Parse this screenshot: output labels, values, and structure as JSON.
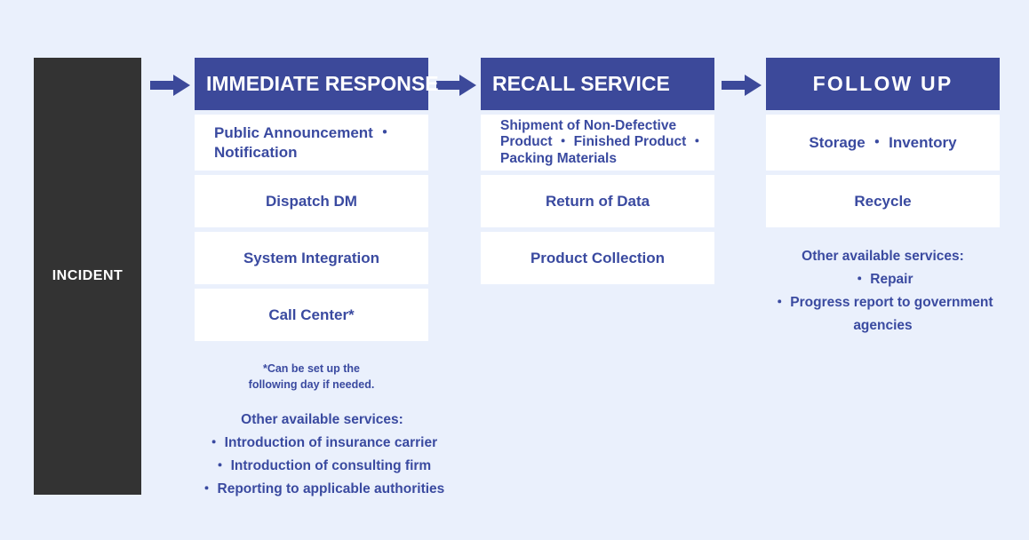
{
  "colors": {
    "background": "#eaf0fc",
    "header_blue": "#3c499a",
    "text_blue": "#3a4aa0",
    "incident_dark": "#333333",
    "box_white": "#ffffff"
  },
  "incident": {
    "label": "INCIDENT"
  },
  "arrows": [
    {
      "name": "arrow-incident-to-immediate"
    },
    {
      "name": "arrow-immediate-to-recall"
    },
    {
      "name": "arrow-recall-to-followup"
    }
  ],
  "columns": [
    {
      "id": "immediate-response",
      "header": "IMMEDIATE RESPONSE",
      "items": [
        {
          "text": "Public Announcement ・\nNotification",
          "align": "left",
          "size": "std",
          "height": "tall"
        },
        {
          "text": "Dispatch DM",
          "align": "center",
          "size": "std",
          "height": "std"
        },
        {
          "text": "System Integration",
          "align": "center",
          "size": "std",
          "height": "std"
        },
        {
          "text": "Call Center*",
          "align": "center",
          "size": "std",
          "height": "std"
        }
      ],
      "footnote": [
        "*Can be set up the",
        "following day if needed."
      ],
      "services": [
        "Other available services:",
        "・ Introduction of insurance carrier",
        "・ Introduction of consulting firm",
        "・ Reporting to applicable authorities"
      ]
    },
    {
      "id": "recall-service",
      "header": "RECALL SERVICE",
      "items": [
        {
          "text": "Shipment of Non-Defective\nProduct ・ Finished Product ・\nPacking Materials",
          "align": "left",
          "size": "small",
          "height": "tall"
        },
        {
          "text": "Return of Data",
          "align": "center",
          "size": "std",
          "height": "std"
        },
        {
          "text": "Product Collection",
          "align": "center",
          "size": "std",
          "height": "std"
        }
      ],
      "footnote": [],
      "services": []
    },
    {
      "id": "follow-up",
      "header": "FOLLOW UP",
      "items": [
        {
          "text": "Storage ・ Inventory",
          "align": "center",
          "size": "std",
          "height": "tall"
        },
        {
          "text": "Recycle",
          "align": "center",
          "size": "std",
          "height": "std"
        }
      ],
      "footnote": [],
      "services": [
        "Other available services:",
        "・ Repair",
        "・ Progress report to government agencies"
      ]
    }
  ]
}
